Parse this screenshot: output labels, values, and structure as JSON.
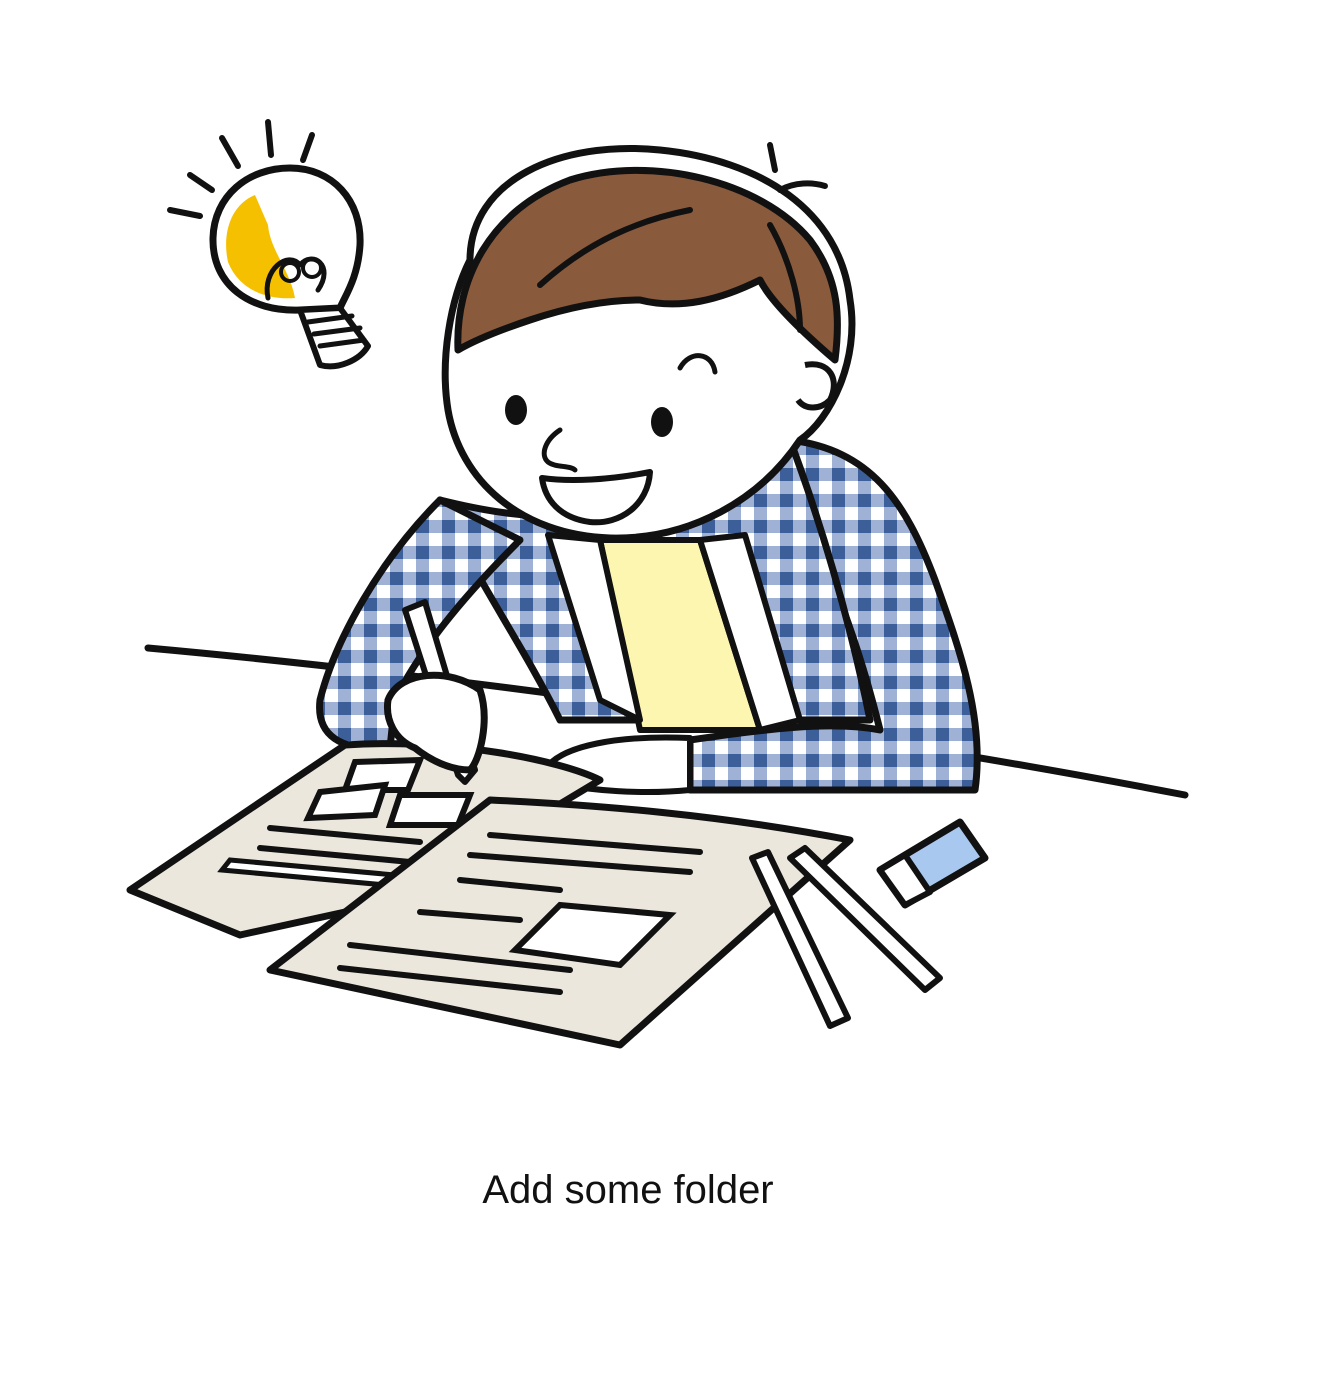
{
  "empty_state": {
    "message": "Add some folder",
    "illustration": {
      "icon": "student-studying-illustration",
      "idea_icon": "lightbulb-icon"
    }
  },
  "colors": {
    "background": "#ffffff",
    "outline": "#111111",
    "hair": "#8a5a3c",
    "shirt_check": "#3d5f99",
    "inner_shirt": "#fdf6b0",
    "bulb": "#f5c000",
    "paper": "#ece7dd",
    "eraser": "#a9c8f0",
    "message_text": "#111111"
  }
}
